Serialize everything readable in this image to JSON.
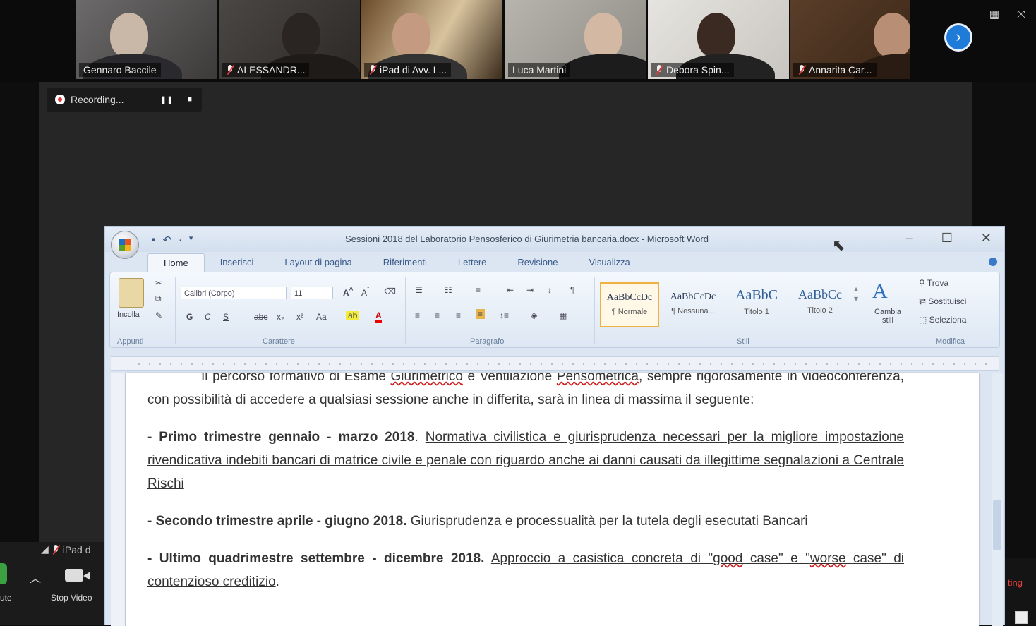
{
  "participants": [
    {
      "name": "Gennaro Baccile",
      "muted": false
    },
    {
      "name": "ALESSANDR...",
      "muted": true
    },
    {
      "name": "iPad di Avv. L...",
      "muted": true
    },
    {
      "name": "Luca Martini",
      "muted": false
    },
    {
      "name": "Debora Spin...",
      "muted": true
    },
    {
      "name": "Annarita Car...",
      "muted": true
    }
  ],
  "recording": {
    "label": "Recording..."
  },
  "bottom_bar": {
    "video_label": "Stop Video",
    "ipad_label": "iPad d",
    "cut_left": "ute",
    "cut_right": "ting"
  },
  "word": {
    "title": "Sessioni 2018 del Laboratorio  Pensosferico di Giurimetria bancaria.docx - Microsoft Word",
    "tabs": [
      "Home",
      "Inserisci",
      "Layout di pagina",
      "Riferimenti",
      "Lettere",
      "Revisione",
      "Visualizza"
    ],
    "font_name": "Calibri (Corpo)",
    "font_size": "11",
    "clipboard_label": "Incolla",
    "groups": [
      "Appunti",
      "Carattere",
      "Paragrafo",
      "Stili",
      "Modifica"
    ],
    "styles": [
      {
        "sample": "AaBbCcDc",
        "name": "¶ Normale"
      },
      {
        "sample": "AaBbCcDc",
        "name": "¶ Nessuna..."
      },
      {
        "sample": "AaBbC",
        "name": "Titolo 1"
      },
      {
        "sample": "AaBbCc",
        "name": "Titolo 2"
      }
    ],
    "change_styles": "Cambia stili",
    "edit_items": [
      "Trova",
      "Sostituisci",
      "Seleziona"
    ]
  },
  "document": {
    "intro_a": "Il percorso formativo di Esame ",
    "intro_b": "Giurimetrico",
    "intro_c": " e Ventilazione ",
    "intro_d": "Pensometrica",
    "intro_e": ", sempre rigorosamente in videoconferenza, con possibilità di accedere a qualsiasi sessione anche in differita, sarà in linea di massima il seguente:",
    "p1_bold": "- Primo trimestre gennaio - marzo 2018",
    "p1_text": "Normativa civilistica e giurisprudenza necessari per la migliore impostazione rivendicativa indebiti bancari di matrice civile e penale con  riguardo anche ai danni causati da illegittime segnalazioni a Centrale Rischi",
    "p2_bold": "- Secondo trimestre aprile - giugno 2018.",
    "p2_text": "Giurisprudenza e processualità per la tutela degli esecutati Bancari",
    "p3_bold": "- Ultimo quadrimestre settembre  - dicembre 2018.",
    "p3_text_a": "Approccio a casistica concreta di \"",
    "p3_good": "good",
    "p3_text_b": " case\" e \"",
    "p3_worse": "worse",
    "p3_text_c": " case\" di contenzioso creditizio"
  },
  "colors": {
    "accent": "#1e7bd8",
    "recording": "#e23a3a",
    "word_chrome": "#dce6f3"
  }
}
